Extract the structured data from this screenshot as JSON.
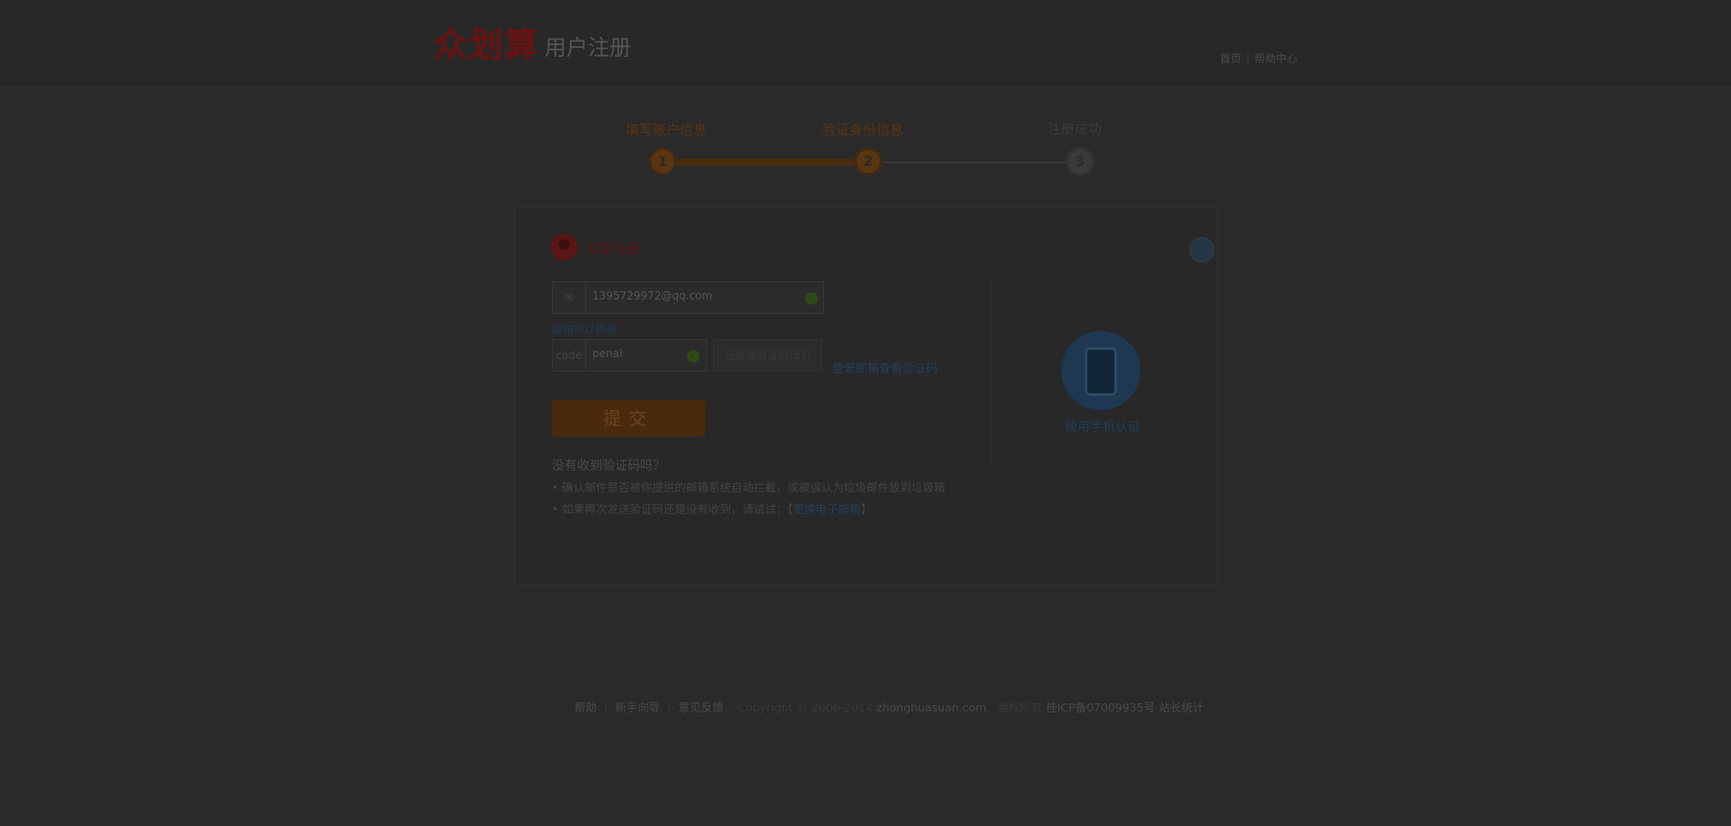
{
  "header": {
    "brand": "众划算",
    "subtitle": "用户注册",
    "nav": [
      "首页",
      "帮助中心"
    ]
  },
  "steps": [
    {
      "label": "填写账户信息",
      "number": "1",
      "state": "done"
    },
    {
      "label": "验证身份信息",
      "number": "2",
      "state": "current"
    },
    {
      "label": "注册成功",
      "number": "3",
      "state": "pending"
    }
  ],
  "section": {
    "title": "买家注册"
  },
  "form": {
    "email_prefix": "✉",
    "email_value": "1395729972@qq.com",
    "email_hint": "邮箱可以使用",
    "code_prefix": "code",
    "code_value": "penal",
    "send_button": "已发送验证码(31)",
    "login_link": "登录邮箱查看验证码",
    "submit": "提交"
  },
  "help": {
    "title": "没有收到验证码吗？",
    "line1": "• 确认邮件是否被你提供的邮箱系统自动拦截，或被误认为垃圾邮件放到垃圾箱",
    "line2_prefix": "• 如果再次发送验证码还是没有收到，请试试：【",
    "line2_link": "更换电子邮箱",
    "line2_suffix": "】"
  },
  "side": {
    "phone_label": "使用手机认证"
  },
  "footer": {
    "links": [
      "帮助",
      "新手向导",
      "意见反馈"
    ],
    "copyright": "Copyright © 2006-2014",
    "domain": "zhonghuasuan.com",
    "rights": "版权所有",
    "icp": "桂ICP备07009935号",
    "stats": "站长统计"
  },
  "colors": {
    "accent": "#ff6a00",
    "brand_red": "#c0001a",
    "link": "#1a73c8",
    "overlay": "#2a2a2a"
  }
}
